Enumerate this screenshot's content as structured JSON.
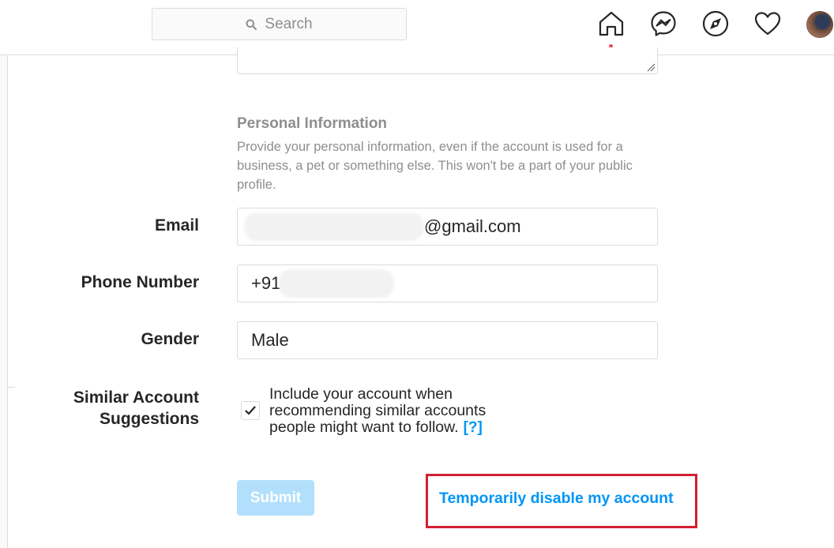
{
  "header": {
    "search_placeholder": "Search",
    "icons": [
      "home-icon",
      "messenger-icon",
      "explore-icon",
      "activity-heart-icon",
      "profile-avatar"
    ]
  },
  "personal_info": {
    "title": "Personal Information",
    "description": "Provide your personal information, even if the account is used for a business, a pet or something else. This won't be a part of your public profile."
  },
  "fields": {
    "email": {
      "label": "Email",
      "value_suffix": "@gmail.com"
    },
    "phone": {
      "label": "Phone Number",
      "value_prefix": "+91"
    },
    "gender": {
      "label": "Gender",
      "value": "Male"
    }
  },
  "similar_accounts": {
    "label_line1": "Similar Account",
    "label_line2": "Suggestions",
    "checked": true,
    "text": "Include your account when recommending similar accounts people might want to follow.",
    "help": "[?]"
  },
  "actions": {
    "submit_label": "Submit",
    "disable_label": "Temporarily disable my account"
  },
  "colors": {
    "link": "#0095f6",
    "submit_disabled": "#b2dffc",
    "highlight_border": "#d32030",
    "notification_dot": "#ed4956"
  }
}
